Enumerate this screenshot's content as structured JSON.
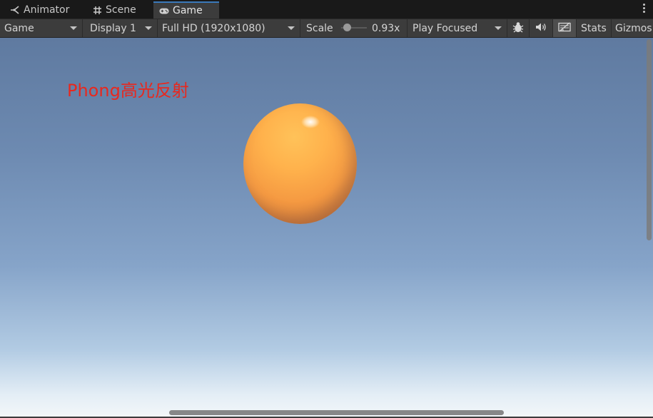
{
  "tabs": [
    {
      "label": "Animator",
      "icon": "animator-icon"
    },
    {
      "label": "Scene",
      "icon": "grid-icon"
    },
    {
      "label": "Game",
      "icon": "gamepad-icon",
      "active": true
    }
  ],
  "toolbar": {
    "view_select": "Game",
    "display_select": "Display 1",
    "resolution_select": "Full HD (1920x1080)",
    "scale_label": "Scale",
    "scale_value": "0.93x",
    "play_mode_select": "Play Focused",
    "stats_label": "Stats",
    "gizmos_label": "Gizmos"
  },
  "viewport": {
    "overlay_text": "Phong高光反射"
  },
  "colors": {
    "accent": "#3a79bb",
    "overlay_text": "#e8281e",
    "sphere": "#ffb24c",
    "sky_top": "#5f7aa0",
    "sky_bottom": "#f3f7f9"
  }
}
